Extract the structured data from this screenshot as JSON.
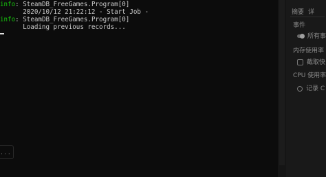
{
  "console": {
    "lines": [
      {
        "tag": "info",
        "sep": ": ",
        "text": "SteamDB_FreeGames.Program[0]"
      },
      {
        "tag": "",
        "sep": "",
        "text": "      2020/10/12 21:22:12 - Start Job -"
      },
      {
        "tag": "info",
        "sep": ": ",
        "text": "SteamDB_FreeGames.Program[0]"
      },
      {
        "tag": "",
        "sep": "",
        "text": "      Loading previous records..."
      }
    ],
    "overflow_indicator": "..."
  },
  "side_panel": {
    "tabs": [
      "摘要",
      "详"
    ],
    "items": [
      {
        "label": "事件",
        "icon": ""
      },
      {
        "label": "所有事",
        "icon": "toggle-icon"
      },
      {
        "label": "内存使用率",
        "icon": ""
      },
      {
        "label": "截取快",
        "icon": "snapshot-icon"
      },
      {
        "label": "CPU 使用率",
        "icon": ""
      },
      {
        "label": "记录 C",
        "icon": "record-icon"
      }
    ]
  },
  "colors": {
    "background": "#0c0c0c",
    "text": "#cccccc",
    "info_tag": "#16c60c",
    "side_panel_bg": "#191919"
  }
}
